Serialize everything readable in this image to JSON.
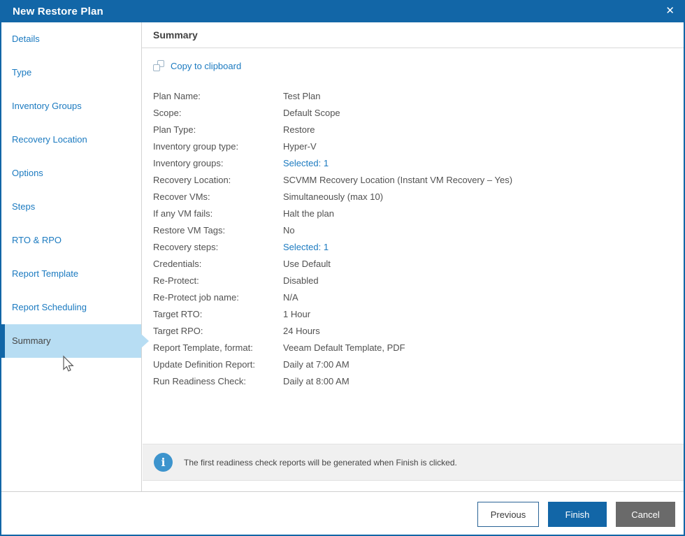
{
  "dialog": {
    "title": "New Restore Plan"
  },
  "icons": {
    "close": "✕",
    "info": "i"
  },
  "colors": {
    "titlebar": "#1266a7",
    "link": "#1b7ac0",
    "active_highlight": "#b7ddf3",
    "active_accent": "#1266a7",
    "info_icon": "#3d94cd",
    "finish_button": "#1266a7",
    "cancel_button": "#6a6a6a"
  },
  "sidebar": {
    "items": [
      {
        "label": "Details",
        "active": false
      },
      {
        "label": "Type",
        "active": false
      },
      {
        "label": "Inventory Groups",
        "active": false
      },
      {
        "label": "Recovery Location",
        "active": false
      },
      {
        "label": "Options",
        "active": false
      },
      {
        "label": "Steps",
        "active": false
      },
      {
        "label": "RTO & RPO",
        "active": false
      },
      {
        "label": "Report Template",
        "active": false
      },
      {
        "label": "Report Scheduling",
        "active": false
      },
      {
        "label": "Summary",
        "active": true
      }
    ]
  },
  "content": {
    "header": "Summary",
    "copy_link": "Copy to clipboard",
    "rows": [
      {
        "label": "Plan Name:",
        "value": "Test Plan",
        "link": false
      },
      {
        "label": "Scope:",
        "value": "Default Scope",
        "link": false
      },
      {
        "label": "Plan Type:",
        "value": "Restore",
        "link": false
      },
      {
        "label": "Inventory group type:",
        "value": "Hyper-V",
        "link": false
      },
      {
        "label": "Inventory groups:",
        "value": "Selected: 1",
        "link": true
      },
      {
        "label": "Recovery Location:",
        "value": "SCVMM Recovery Location (Instant VM Recovery – Yes)",
        "link": false
      },
      {
        "label": "Recover VMs:",
        "value": "Simultaneously (max 10)",
        "link": false
      },
      {
        "label": "If any VM fails:",
        "value": "Halt the plan",
        "link": false
      },
      {
        "label": "Restore VM Tags:",
        "value": "No",
        "link": false
      },
      {
        "label": "Recovery steps:",
        "value": "Selected: 1",
        "link": true
      },
      {
        "label": "Credentials:",
        "value": "Use Default",
        "link": false
      },
      {
        "label": "Re-Protect:",
        "value": "Disabled",
        "link": false
      },
      {
        "label": "Re-Protect job name:",
        "value": "N/A",
        "link": false
      },
      {
        "label": "Target RTO:",
        "value": "1 Hour",
        "link": false
      },
      {
        "label": "Target RPO:",
        "value": "24 Hours",
        "link": false
      },
      {
        "label": "Report Template, format:",
        "value": "Veeam Default Template, PDF",
        "link": false
      },
      {
        "label": "Update Definition Report:",
        "value": "Daily at 7:00 AM",
        "link": false
      },
      {
        "label": "Run Readiness Check:",
        "value": "Daily at 8:00 AM",
        "link": false
      }
    ],
    "info": "The first readiness check reports will be generated when Finish is clicked."
  },
  "footer": {
    "previous": "Previous",
    "finish": "Finish",
    "cancel": "Cancel"
  }
}
